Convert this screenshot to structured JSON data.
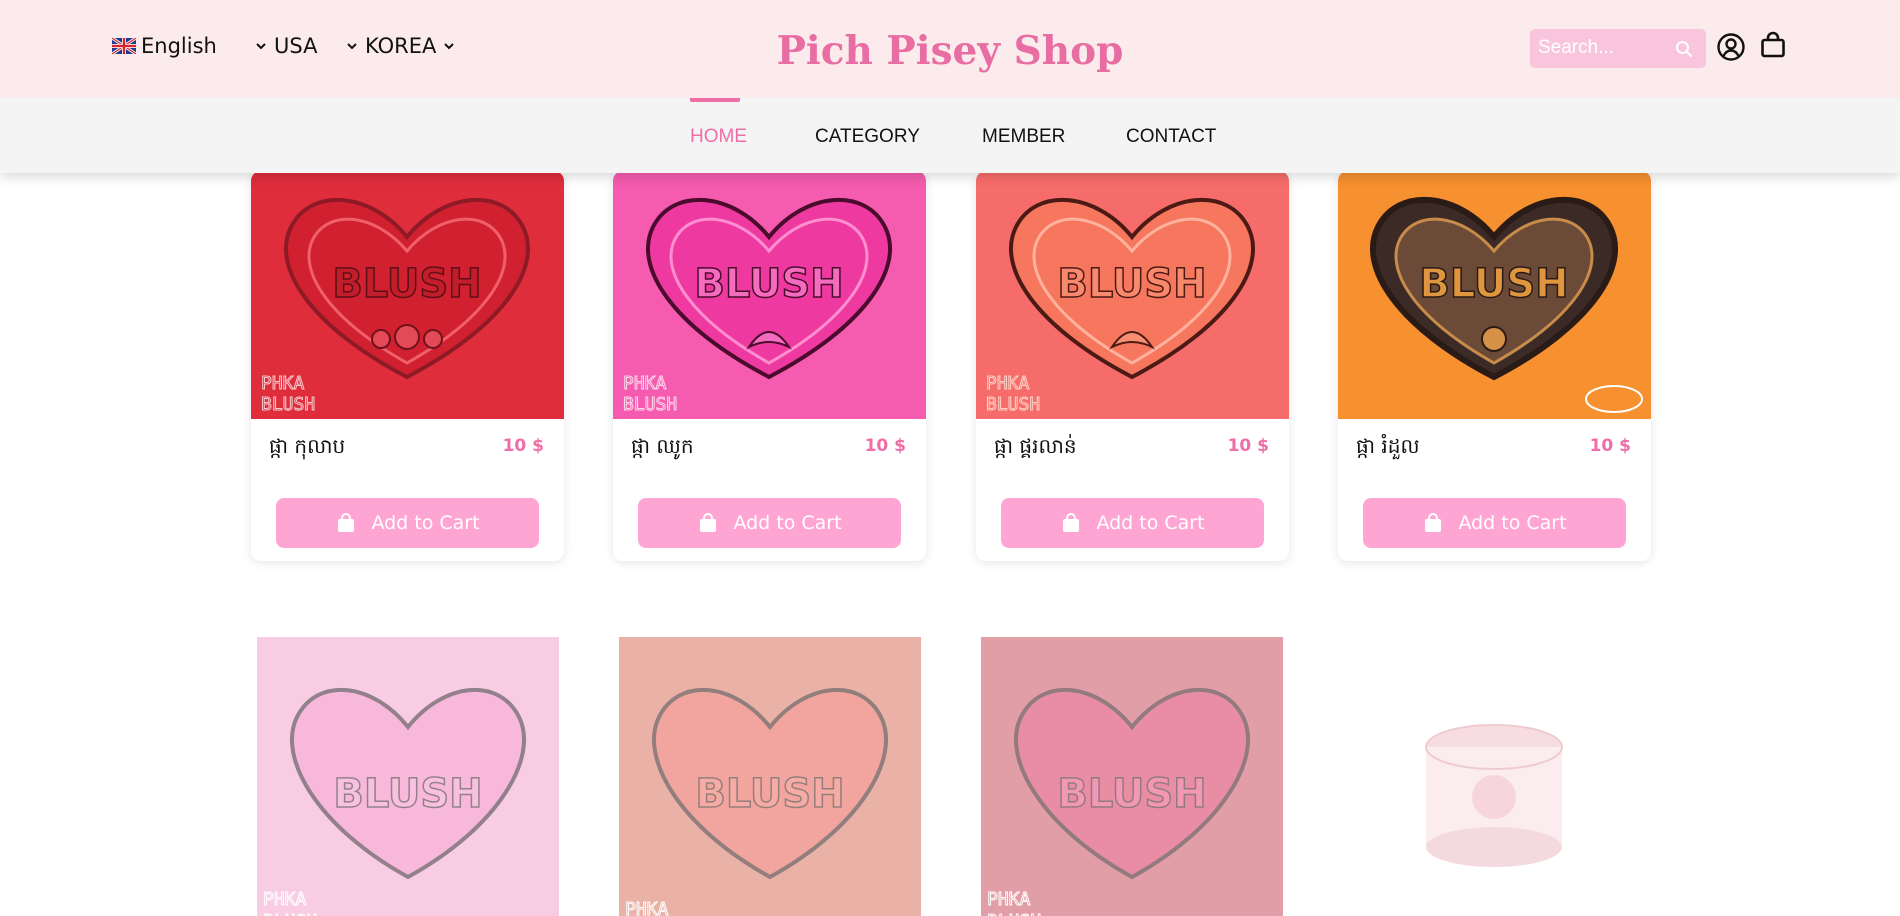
{
  "header": {
    "language": "English",
    "region": "USA",
    "country": "KOREA",
    "brand": "Pich Pisey Shop",
    "search_placeholder": "Search...",
    "icons": {
      "search": "search-icon",
      "account": "user-circle-icon",
      "cart": "shopping-bag-icon"
    }
  },
  "nav": {
    "items": [
      {
        "label": "HOME",
        "active": true
      },
      {
        "label": "CATEGORY"
      },
      {
        "label": "MEMBER"
      },
      {
        "label": "CONTACT"
      }
    ]
  },
  "products": [
    {
      "name": "ផ្កា កុលាប",
      "price": "10 $",
      "button": "Add to Cart",
      "color": "#e02d3c"
    },
    {
      "name": "ផ្កា ឈូក",
      "price": "10 $",
      "button": "Add to Cart",
      "color": "#f24da7"
    },
    {
      "name": "ផ្កា ផ្គរលាន់",
      "price": "10 $",
      "button": "Add to Cart",
      "color": "#f66c6a"
    },
    {
      "name": "ផ្កា រំដួល",
      "price": "10 $",
      "button": "Add to Cart",
      "color": "#f7902f"
    }
  ],
  "more_products": [
    {
      "color": "#f3a5cf"
    },
    {
      "color": "#d9745f"
    },
    {
      "color": "#c9505e"
    },
    {
      "color": "#ffffff"
    }
  ],
  "theme": {
    "accent": "#f06ea8",
    "header_bg": "#fcebec",
    "button_bg": "#fea5d4"
  }
}
